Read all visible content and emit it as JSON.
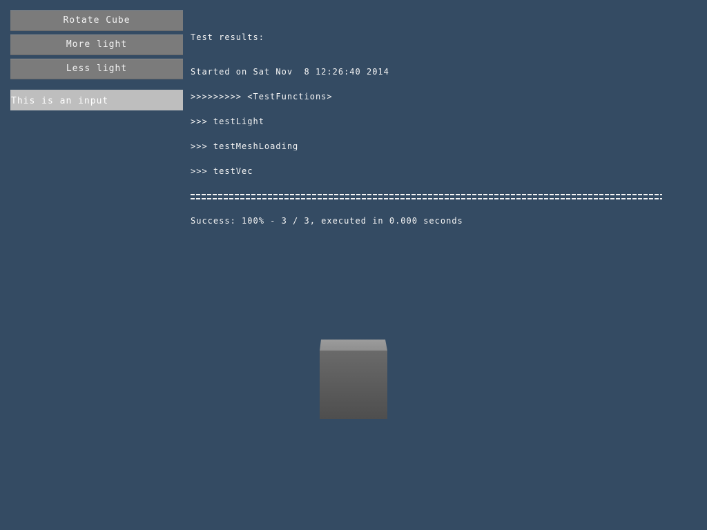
{
  "controls": {
    "rotate_label": "Rotate Cube",
    "more_light_label": "More light",
    "less_light_label": "Less light",
    "input_value": "This is an input"
  },
  "results": {
    "title": "Test results:",
    "lines": [
      "Started on Sat Nov  8 12:26:40 2014",
      ">>>>>>>>> <TestFunctions>",
      ">>> testLight",
      ">>> testMeshLoading",
      ">>> testVec"
    ],
    "summary": "Success: 100% - 3 / 3, executed in 0.000 seconds"
  },
  "scene": {
    "background_color": "#344B63",
    "cube_top_color": "#9C9C9C",
    "cube_front_top_color": "#6A6A6A",
    "cube_front_bottom_color": "#4E4E4E"
  }
}
